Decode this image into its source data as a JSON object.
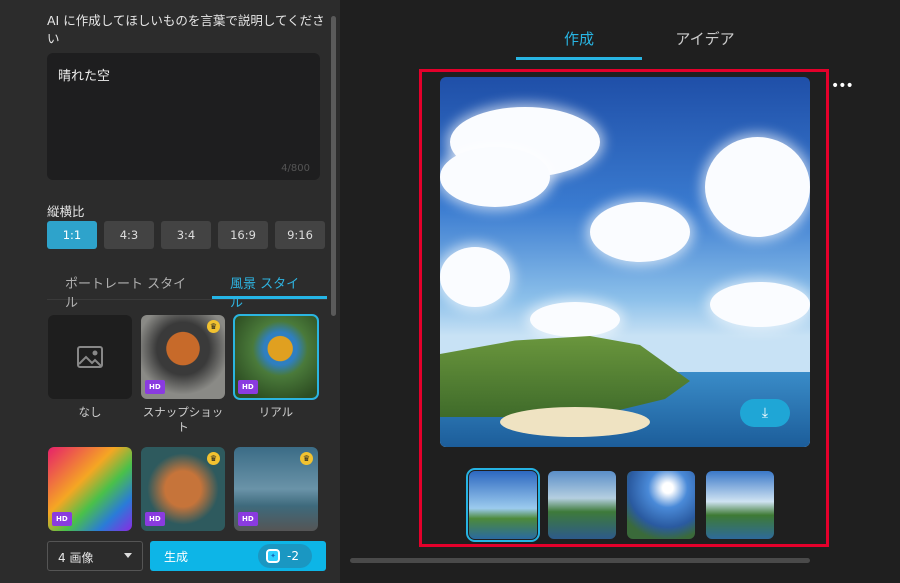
{
  "prompt": {
    "label": "AI に作成してほしいものを言葉で説明してください",
    "value": "晴れた空",
    "counter": "4/800"
  },
  "aspect": {
    "label": "縦横比",
    "options": [
      "1:1",
      "4:3",
      "3:4",
      "16:9",
      "9:16"
    ],
    "selected": "1:1"
  },
  "style_tabs": [
    "ポートレート スタイル",
    "風景 スタイル"
  ],
  "styles": [
    {
      "label": "なし"
    },
    {
      "label": "スナップショット",
      "badge": "HD"
    },
    {
      "label": "リアル",
      "badge": "HD"
    },
    {
      "label": "",
      "badge": "HD"
    },
    {
      "label": "",
      "badge": "HD"
    },
    {
      "label": "",
      "badge": "HD"
    }
  ],
  "count_select": "4 画像",
  "generate": {
    "label": "生成",
    "cost": "-2"
  },
  "main_tabs": [
    "作成",
    "アイデア"
  ],
  "more": "•••",
  "colors": {
    "accent": "#0db5e7",
    "highlight": "#e4002b"
  }
}
